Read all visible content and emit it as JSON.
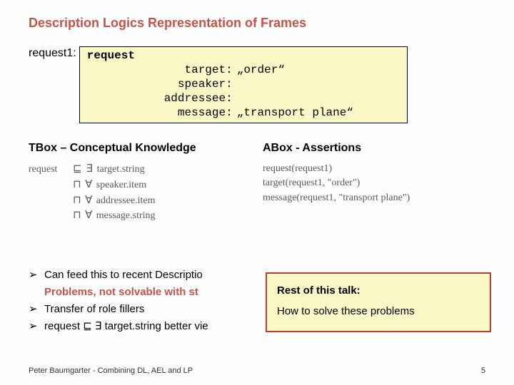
{
  "title": "Description Logics Representation of Frames",
  "frame": {
    "label": "request1:",
    "head": "request",
    "slots": [
      {
        "k": "target:",
        "v": "„order“"
      },
      {
        "k": "speaker:",
        "v": ""
      },
      {
        "k": "addressee:",
        "v": ""
      },
      {
        "k": "message:",
        "v": "„transport plane“"
      }
    ]
  },
  "tbox": {
    "heading": "TBox – Conceptual Knowledge",
    "lead": "request",
    "rows": [
      {
        "op": "⊑",
        "q": "∃",
        "body": "target.string"
      },
      {
        "op": "⊓",
        "q": "∀",
        "body": "speaker.item"
      },
      {
        "op": "⊓",
        "q": "∀",
        "body": "addressee.item"
      },
      {
        "op": "⊓",
        "q": "∀",
        "body": "message.string"
      }
    ]
  },
  "abox": {
    "heading": "ABox - Assertions",
    "lines": [
      "request(request1)",
      "target(request1, \"order\")",
      "message(request1, \"transport plane\")"
    ]
  },
  "bullets": {
    "b1_a": "Can feed this to recent Descriptio",
    "b1_line2_pre": "Problems, not solvable with st",
    "b2": "Transfer of role fillers",
    "b3": "request ⊑ ∃ target.string better vie"
  },
  "overlay": {
    "line1": "Rest of this talk:",
    "line2": "How to solve these problems"
  },
  "footer": {
    "left": "Peter Baumgarter - Combining DL, AEL and LP",
    "right": "5"
  }
}
